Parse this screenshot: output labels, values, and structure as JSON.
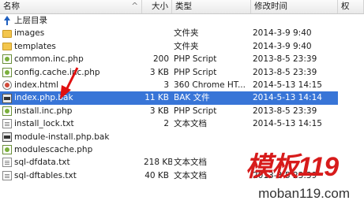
{
  "columns": {
    "name": "名称",
    "size": "大小",
    "type": "类型",
    "modified": "修改时间",
    "extra": "权"
  },
  "parent_dir": {
    "label": "上层目录",
    "icon": "up-arrow-icon"
  },
  "files": [
    {
      "name": "images",
      "size": "",
      "type": "文件夹",
      "modified": "2014-3-9 9:40",
      "icon": "folder-icon"
    },
    {
      "name": "templates",
      "size": "",
      "type": "文件夹",
      "modified": "2014-3-9 9:40",
      "icon": "folder-icon"
    },
    {
      "name": "common.inc.php",
      "size": "200",
      "type": "PHP Script",
      "modified": "2013-8-5 23:39",
      "icon": "php-icon"
    },
    {
      "name": "config.cache.inc.php",
      "size": "3 KB",
      "type": "PHP Script",
      "modified": "2013-8-5 23:39",
      "icon": "php-icon"
    },
    {
      "name": "index.html",
      "size": "3",
      "type": "360 Chrome HT...",
      "modified": "2014-5-13 14:15",
      "icon": "html-icon"
    },
    {
      "name": "index.php.bak",
      "size": "11 KB",
      "type": "BAK 文件",
      "modified": "2014-5-13 14:14",
      "icon": "bak-icon",
      "selected": true
    },
    {
      "name": "install.inc.php",
      "size": "3 KB",
      "type": "PHP Script",
      "modified": "2013-8-5 23:39",
      "icon": "php-icon"
    },
    {
      "name": "install_lock.txt",
      "size": "2",
      "type": "文本文档",
      "modified": "2014-5-13 14:15",
      "icon": "txt-icon"
    },
    {
      "name": "module-install.php.bak",
      "size": "",
      "type": "",
      "modified": "",
      "icon": "bak-icon"
    },
    {
      "name": "modulescache.php",
      "size": "",
      "type": "",
      "modified": "",
      "icon": "php-icon"
    },
    {
      "name": "sql-dfdata.txt",
      "size": "218 KB",
      "type": "文本文档",
      "modified": "",
      "icon": "txt-icon"
    },
    {
      "name": "sql-dftables.txt",
      "size": "40 KB",
      "type": "文本文档",
      "modified": "2013-8-5 23:39",
      "icon": "txt-icon"
    }
  ],
  "watermark": {
    "logo": "模板119",
    "url": "moban119.com"
  },
  "colors": {
    "selection": "#3875d7",
    "watermark_red": "#d71b1b",
    "folder": "#f3c64d"
  }
}
